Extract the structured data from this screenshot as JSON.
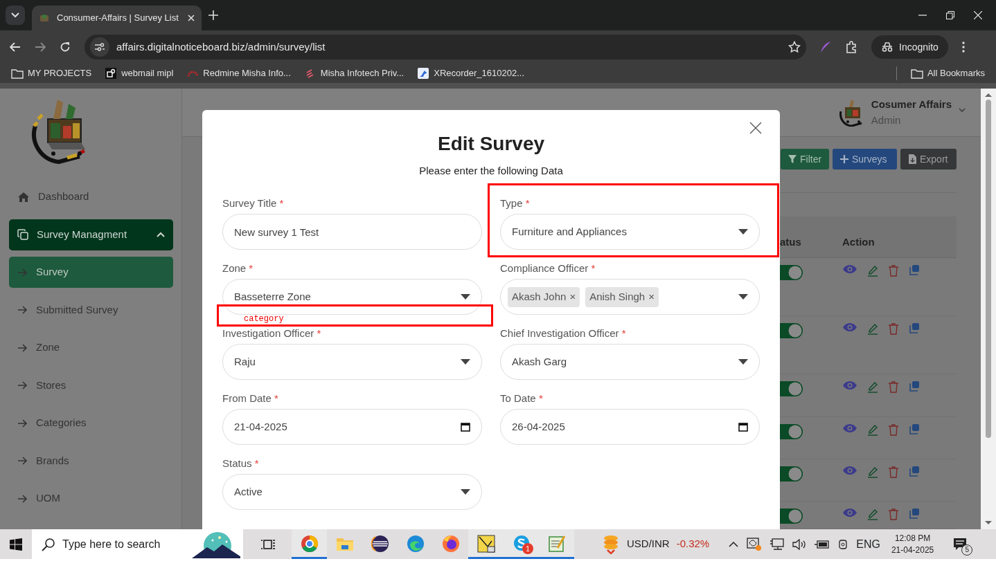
{
  "browser": {
    "tab_title": "Consumer-Affairs | Survey List",
    "url": "affairs.digitalnoticeboard.biz/admin/survey/list",
    "profile": "Incognito",
    "bookmarks": [
      {
        "label": "MY PROJECTS"
      },
      {
        "label": "webmail mipl"
      },
      {
        "label": "Redmine Misha Info..."
      },
      {
        "label": "Misha Infotech Priv..."
      },
      {
        "label": "XRecorder_1610202..."
      }
    ],
    "all_bookmarks": "All Bookmarks"
  },
  "sidebar": {
    "items": [
      {
        "label": "Dashboard",
        "selected": false
      },
      {
        "label": "Survey Managment",
        "selected": true,
        "expanded": true,
        "children": [
          {
            "label": "Survey",
            "selected": true
          },
          {
            "label": "Submitted Survey",
            "selected": false
          },
          {
            "label": "Zone",
            "selected": false
          },
          {
            "label": "Stores",
            "selected": false
          },
          {
            "label": "Categories",
            "selected": false
          },
          {
            "label": "Brands",
            "selected": false
          },
          {
            "label": "UOM",
            "selected": false
          }
        ]
      }
    ]
  },
  "header": {
    "user_name": "Cosumer Affairs",
    "user_role": "Admin"
  },
  "toolbar": {
    "buttons": [
      {
        "label": "Filter",
        "kind": "filter"
      },
      {
        "label": "Surveys",
        "kind": "add"
      },
      {
        "label": "Export",
        "kind": "export"
      }
    ]
  },
  "table": {
    "columns": [
      "atus",
      "Action"
    ],
    "rows": [
      {
        "on": true
      },
      {
        "on": true
      },
      {
        "on": true
      },
      {
        "on": true
      },
      {
        "on": true
      },
      {
        "on": true
      }
    ]
  },
  "modal": {
    "title": "Edit Survey",
    "subtitle": "Please enter the following Data",
    "fields": [
      {
        "kind": "text",
        "label": "Survey Title",
        "required_mark": "*",
        "value": "New survey 1 Test"
      },
      {
        "kind": "select",
        "label": "Type",
        "required_mark": "*",
        "value": "Furniture and Appliances"
      },
      {
        "kind": "select",
        "label": "Zone",
        "required_mark": "*",
        "value": "Basseterre Zone"
      },
      {
        "kind": "multiselect",
        "label": "Compliance Officer",
        "required_mark": "*",
        "chips": [
          {
            "label": "Akash John",
            "remove": "×"
          },
          {
            "label": "Anish Singh",
            "remove": "×"
          }
        ]
      },
      {
        "kind": "select",
        "label": "Investigation Officer",
        "required_mark": "*",
        "value": "Raju"
      },
      {
        "kind": "select",
        "label": "Chief Investigation Officer",
        "required_mark": "*",
        "value": "Akash Garg"
      },
      {
        "kind": "date",
        "label": "From Date",
        "required_mark": "*",
        "value": "21-04-2025"
      },
      {
        "kind": "date",
        "label": "To Date",
        "required_mark": "*",
        "value": "26-04-2025"
      },
      {
        "kind": "select",
        "label": "Status",
        "required_mark": "*",
        "value": "Active"
      }
    ]
  },
  "annotations": [
    {
      "kind": "box"
    },
    {
      "kind": "box",
      "label": "category"
    }
  ],
  "taskbar": {
    "search_placeholder": "Type here to search",
    "apps": [
      {
        "active": true
      },
      {
        "active": false
      },
      {
        "active": false
      },
      {
        "active": false
      },
      {
        "active": false
      },
      {
        "active": true
      },
      {
        "active": true,
        "badge": "1"
      },
      {
        "active": true
      }
    ],
    "ticker": {
      "symbol": "USD/INR",
      "change": "-0.32%"
    },
    "language": "ENG",
    "time": "12:08 PM",
    "date": "21-04-2025",
    "notifications": "5"
  }
}
